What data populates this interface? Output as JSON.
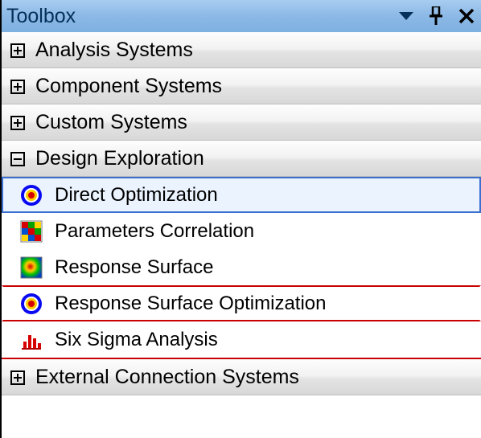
{
  "panel": {
    "title": "Toolbox"
  },
  "sections": {
    "analysis_systems": {
      "label": "Analysis Systems",
      "expanded": false
    },
    "component_systems": {
      "label": "Component Systems",
      "expanded": false
    },
    "custom_systems": {
      "label": "Custom Systems",
      "expanded": false
    },
    "design_exploration": {
      "label": "Design Exploration",
      "expanded": true,
      "items": {
        "direct_optimization": {
          "label": "Direct Optimization"
        },
        "parameters_correlation": {
          "label": "Parameters Correlation"
        },
        "response_surface": {
          "label": "Response Surface"
        },
        "response_surface_optimization": {
          "label": "Response Surface Optimization"
        },
        "six_sigma_analysis": {
          "label": "Six Sigma Analysis"
        }
      }
    },
    "external_connection_systems": {
      "label": "External Connection Systems",
      "expanded": false
    }
  }
}
